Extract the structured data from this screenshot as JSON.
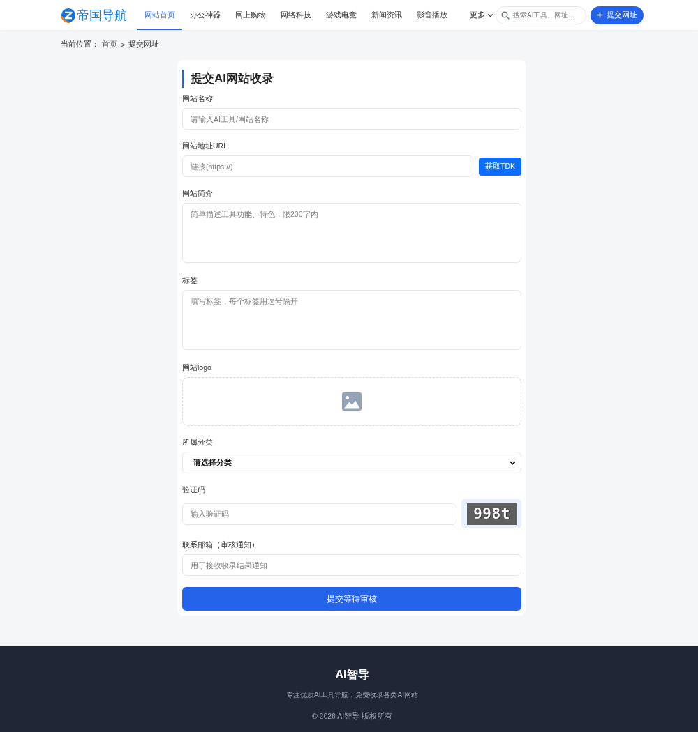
{
  "header": {
    "logo_text": "帝国导航",
    "nav": [
      {
        "label": "网站首页",
        "selected": true
      },
      {
        "label": "办公神器",
        "selected": false
      },
      {
        "label": "网上购物",
        "selected": false
      },
      {
        "label": "网络科技",
        "selected": false
      },
      {
        "label": "游戏电竞",
        "selected": false
      },
      {
        "label": "新闻资讯",
        "selected": false
      },
      {
        "label": "影音播放",
        "selected": false
      }
    ],
    "more_menu": {
      "label": "更多"
    },
    "search": {
      "placeholder": "搜索AI工具、网址..."
    },
    "submit_button": {
      "label": "提交网址"
    }
  },
  "breadcrumb": {
    "prefix": "当前位置：",
    "items": [
      {
        "label": "首页"
      },
      {
        "label": "提交网址"
      }
    ],
    "separator": ">"
  },
  "form": {
    "title": "提交AI网站收录",
    "fields": [
      {
        "kind": "text",
        "label": "网站名称",
        "placeholder": "请输入AI工具/网站名称"
      },
      {
        "kind": "url",
        "label": "网站地址URL",
        "placeholder": "链接(https://)",
        "button": "获取TDK"
      },
      {
        "kind": "textarea",
        "label": "网站简介",
        "placeholder": "简单描述工具功能、特色，限200字内"
      },
      {
        "kind": "textarea",
        "label": "标签",
        "placeholder": "填写标签，每个标签用逗号隔开"
      },
      {
        "kind": "upload",
        "label": "网站logo"
      },
      {
        "kind": "select",
        "label": "所属分类",
        "value": "请选择分类"
      },
      {
        "kind": "captcha",
        "label": "验证码",
        "placeholder": "输入验证码",
        "captcha_text": "998t"
      },
      {
        "kind": "text",
        "label": "联系邮箱（审核通知）",
        "placeholder": "用于接收收录结果通知"
      }
    ],
    "submit": "提交等待审核"
  },
  "footer": {
    "title": "AI智导",
    "tagline": "专注优质AI工具导航，免费收录各类AI网站",
    "copyright": "© 2026 AI智导 版权所有"
  }
}
